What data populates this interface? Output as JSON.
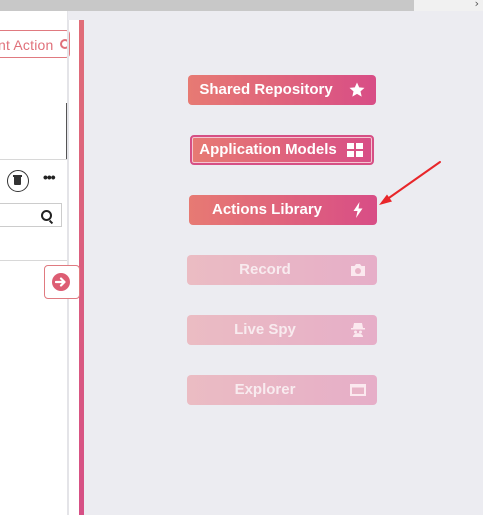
{
  "left_panel": {
    "action_button_label": "nt Action"
  },
  "nav_buttons": [
    {
      "label": "Shared Repository",
      "icon": "star-icon",
      "enabled": true
    },
    {
      "label": "Application Models",
      "icon": "grid-icon",
      "enabled": true
    },
    {
      "label": "Actions Library",
      "icon": "lightning-icon",
      "enabled": true
    },
    {
      "label": "Record",
      "icon": "camera-icon",
      "enabled": false
    },
    {
      "label": "Live Spy",
      "icon": "spy-icon",
      "enabled": false
    },
    {
      "label": "Explorer",
      "icon": "window-icon",
      "enabled": false
    }
  ],
  "colors": {
    "accent": "#d84d86",
    "accent_start": "#e77a73",
    "annotation_arrow": "#e8262a",
    "main_background": "#ececf1"
  }
}
